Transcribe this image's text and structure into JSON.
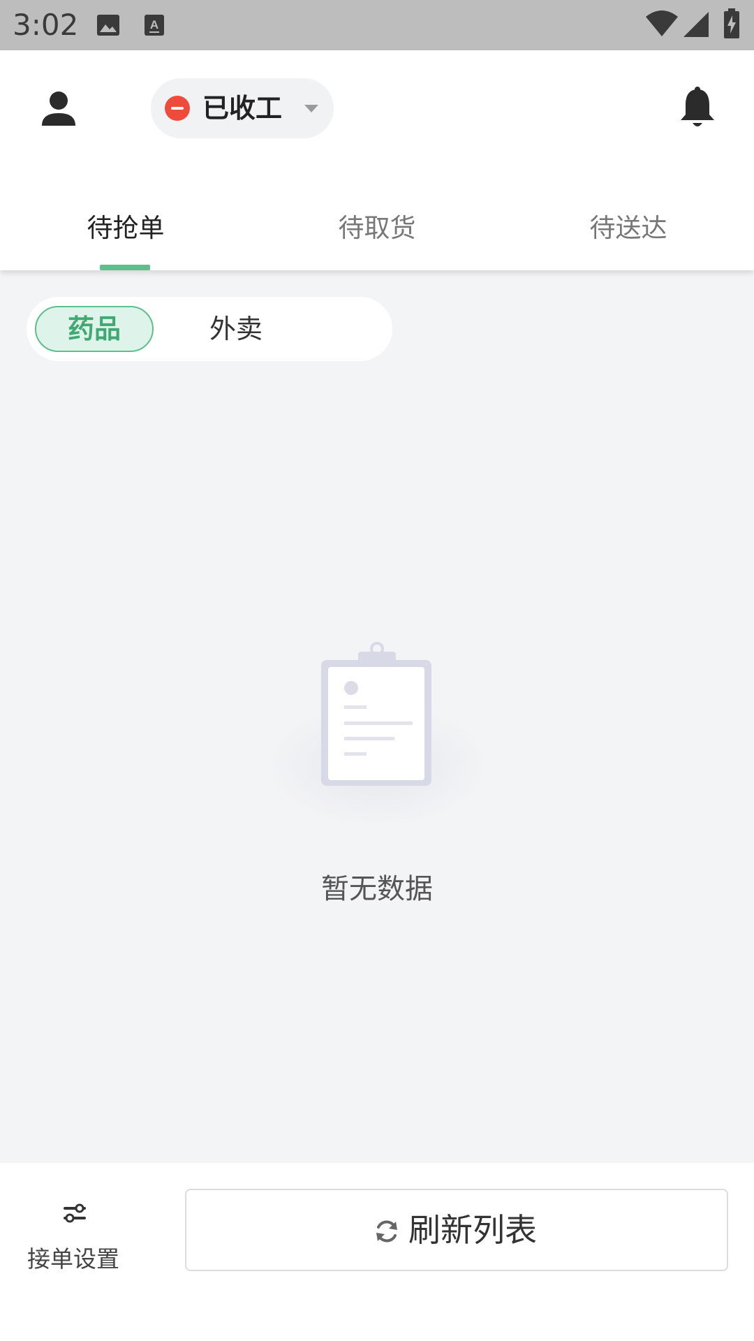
{
  "status_bar": {
    "time": "3:02",
    "icons": [
      "image-icon",
      "text-icon",
      "wifi-icon",
      "signal-icon",
      "battery-charging-icon"
    ]
  },
  "header": {
    "profile_icon": "person-icon",
    "work_status": {
      "label": "已收工",
      "indicator_color": "#ef4b3d"
    },
    "notification_icon": "bell-icon"
  },
  "tabs": [
    {
      "label": "待抢单",
      "active": true
    },
    {
      "label": "待取货",
      "active": false
    },
    {
      "label": "待送达",
      "active": false
    }
  ],
  "category": {
    "items": [
      {
        "label": "药品",
        "active": true
      },
      {
        "label": "外卖",
        "active": false
      }
    ]
  },
  "empty_state": {
    "icon": "clipboard-icon",
    "text": "暂无数据"
  },
  "bottom_bar": {
    "settings_label": "接单设置",
    "settings_icon": "sliders-icon",
    "refresh_label": "刷新列表",
    "refresh_icon": "refresh-icon"
  },
  "colors": {
    "accent": "#5cbf8c",
    "status_red": "#ef4b3d",
    "background": "#f3f4f6"
  }
}
